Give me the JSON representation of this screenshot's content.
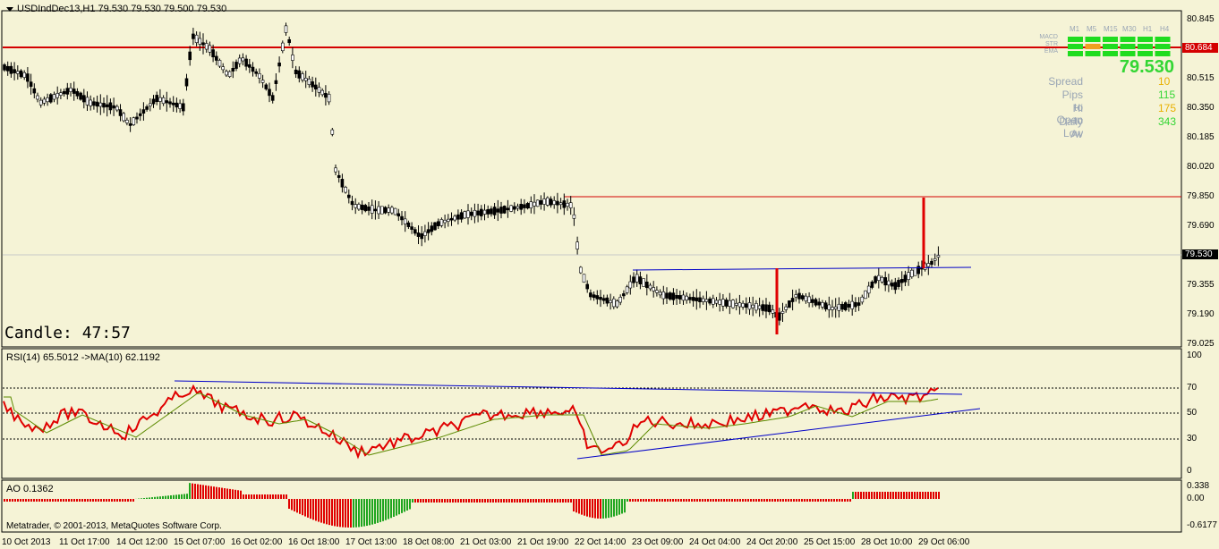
{
  "window": {
    "title": "USDIndDec13,H1  79.530 79.530 79.500 79.530"
  },
  "candle_timer": "Candle:  47:57",
  "price_axis": [
    "80.845",
    "80.680",
    "80.515",
    "80.350",
    "80.185",
    "80.020",
    "79.850",
    "79.690",
    "79.530",
    "79.355",
    "79.190",
    "79.025"
  ],
  "price_tags": {
    "resistance": "80.684",
    "current": "79.530"
  },
  "rsi": {
    "label": "RSI(14) 65.5012  ->MA(10) 62.1192",
    "axis": [
      "100",
      "70",
      "50",
      "30",
      "0"
    ]
  },
  "ao": {
    "label": "AO 0.1362",
    "axis": [
      "0.338",
      "0.00",
      "-0.6177"
    ]
  },
  "copyright": "Metatrader, © 2001-2013, MetaQuotes Software Corp.",
  "time_axis": [
    "10 Oct 2013",
    "11 Oct 17:00",
    "14 Oct 12:00",
    "15 Oct 07:00",
    "16 Oct 02:00",
    "16 Oct 18:00",
    "17 Oct 13:00",
    "18 Oct 08:00",
    "21 Oct 03:00",
    "21 Oct 19:00",
    "22 Oct 14:00",
    "23 Oct 09:00",
    "24 Oct 04:00",
    "24 Oct 20:00",
    "25 Oct 15:00",
    "28 Oct 10:00",
    "29 Oct 06:00"
  ],
  "dashboard": {
    "timeframes": [
      "M1",
      "M5",
      "M15",
      "M30",
      "H1",
      "H4"
    ],
    "indicators": [
      "MACD",
      "STR",
      "EMA"
    ],
    "price": "79.530",
    "rows": [
      {
        "label": "Spread",
        "value": "10",
        "color": "#e8b000"
      },
      {
        "label": "Pips to Open",
        "value": "115",
        "color": "#34d634"
      },
      {
        "label": "Hi to Low",
        "value": "175",
        "color": "#e8b000"
      },
      {
        "label": "Daily Av",
        "value": "343",
        "color": "#34d634"
      }
    ]
  },
  "colors": {
    "background": "#f5f3d6",
    "bull_green": "#1fdc1f",
    "warn_orange": "#f0a020",
    "resistance_red": "#d40000",
    "trend_blue": "#0000c8",
    "rsi_red": "#e00000",
    "ma_olive": "#5c8a00"
  }
}
